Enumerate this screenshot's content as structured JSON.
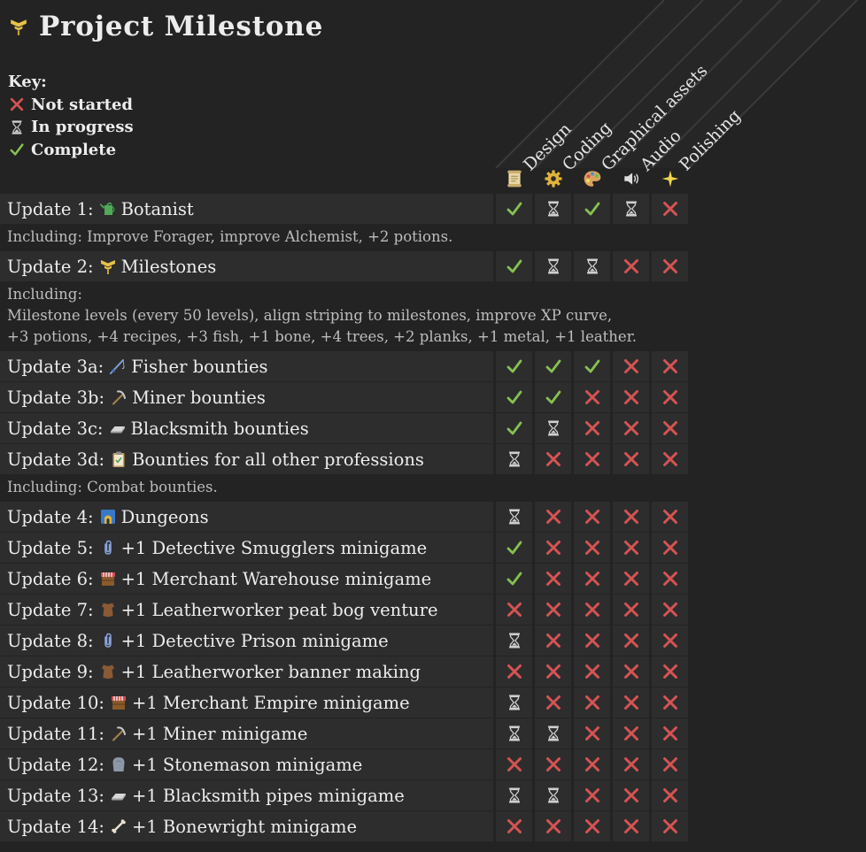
{
  "title": "Project Milestone",
  "title_icon": "milestone-icon",
  "key": {
    "heading": "Key:",
    "items": [
      {
        "status": "x",
        "label": "Not started"
      },
      {
        "status": "p",
        "label": "In progress"
      },
      {
        "status": "c",
        "label": "Complete"
      }
    ]
  },
  "columns": [
    {
      "label": "Design",
      "icon": "scroll-icon"
    },
    {
      "label": "Coding",
      "icon": "gear-icon"
    },
    {
      "label": "Graphical assets",
      "icon": "palette-icon"
    },
    {
      "label": "Audio",
      "icon": "speaker-icon"
    },
    {
      "label": "Polishing",
      "icon": "sparkle-icon"
    }
  ],
  "colors": {
    "complete": "#86c152",
    "not_started": "#d65353",
    "in_progress": "#cfcfcf",
    "background": "#232323",
    "cell": "#2d2d2d"
  },
  "rows": [
    {
      "prefix": "Update 1:",
      "icon": "watering-can-icon",
      "name": "Botanist",
      "status": [
        "c",
        "p",
        "c",
        "p",
        "x"
      ],
      "note": [
        "Including: Improve Forager, improve Alchemist, +2 potions."
      ]
    },
    {
      "prefix": "Update 2:",
      "icon": "milestone-icon",
      "name": "Milestones",
      "status": [
        "c",
        "p",
        "p",
        "x",
        "x"
      ],
      "note": [
        "Including:",
        "Milestone levels (every 50 levels), align striping to milestones, improve XP curve,",
        "+3 potions, +4 recipes, +3 fish, +1 bone, +4 trees, +2 planks, +1 metal, +1 leather."
      ]
    },
    {
      "prefix": "Update 3a:",
      "icon": "fishing-rod-icon",
      "name": "Fisher bounties",
      "status": [
        "c",
        "c",
        "c",
        "x",
        "x"
      ]
    },
    {
      "prefix": "Update 3b:",
      "icon": "pickaxe-icon",
      "name": "Miner bounties",
      "status": [
        "c",
        "c",
        "x",
        "x",
        "x"
      ]
    },
    {
      "prefix": "Update 3c:",
      "icon": "ingot-icon",
      "name": "Blacksmith bounties",
      "status": [
        "c",
        "p",
        "x",
        "x",
        "x"
      ]
    },
    {
      "prefix": "Update 3d:",
      "icon": "clipboard-icon",
      "name": "Bounties for all other professions",
      "status": [
        "p",
        "x",
        "x",
        "x",
        "x"
      ],
      "note": [
        "Including: Combat bounties."
      ]
    },
    {
      "prefix": "Update 4:",
      "icon": "dungeon-map-icon",
      "name": "Dungeons",
      "status": [
        "p",
        "x",
        "x",
        "x",
        "x"
      ]
    },
    {
      "prefix": "Update 5:",
      "icon": "paperclip-icon",
      "name": "+1 Detective Smugglers minigame",
      "status": [
        "c",
        "x",
        "x",
        "x",
        "x"
      ]
    },
    {
      "prefix": "Update 6:",
      "icon": "market-stall-icon",
      "name": "+1 Merchant Warehouse minigame",
      "status": [
        "c",
        "x",
        "x",
        "x",
        "x"
      ]
    },
    {
      "prefix": "Update 7:",
      "icon": "leather-icon",
      "name": "+1 Leatherworker peat bog venture",
      "status": [
        "x",
        "x",
        "x",
        "x",
        "x"
      ]
    },
    {
      "prefix": "Update 8:",
      "icon": "paperclip-icon",
      "name": "+1 Detective Prison minigame",
      "status": [
        "p",
        "x",
        "x",
        "x",
        "x"
      ]
    },
    {
      "prefix": "Update 9:",
      "icon": "leather-icon",
      "name": "+1 Leatherworker banner making",
      "status": [
        "x",
        "x",
        "x",
        "x",
        "x"
      ]
    },
    {
      "prefix": "Update 10:",
      "icon": "market-stall-icon",
      "name": "+1 Merchant Empire minigame",
      "status": [
        "p",
        "x",
        "x",
        "x",
        "x"
      ]
    },
    {
      "prefix": "Update 11:",
      "icon": "pickaxe-icon",
      "name": "+1 Miner minigame",
      "status": [
        "p",
        "p",
        "x",
        "x",
        "x"
      ]
    },
    {
      "prefix": "Update 12:",
      "icon": "stone-icon",
      "name": "+1 Stonemason minigame",
      "status": [
        "x",
        "x",
        "x",
        "x",
        "x"
      ]
    },
    {
      "prefix": "Update 13:",
      "icon": "ingot-icon",
      "name": "+1 Blacksmith pipes minigame",
      "status": [
        "p",
        "p",
        "x",
        "x",
        "x"
      ]
    },
    {
      "prefix": "Update 14:",
      "icon": "bone-icon",
      "name": "+1 Bonewright minigame",
      "status": [
        "x",
        "x",
        "x",
        "x",
        "x"
      ]
    }
  ]
}
